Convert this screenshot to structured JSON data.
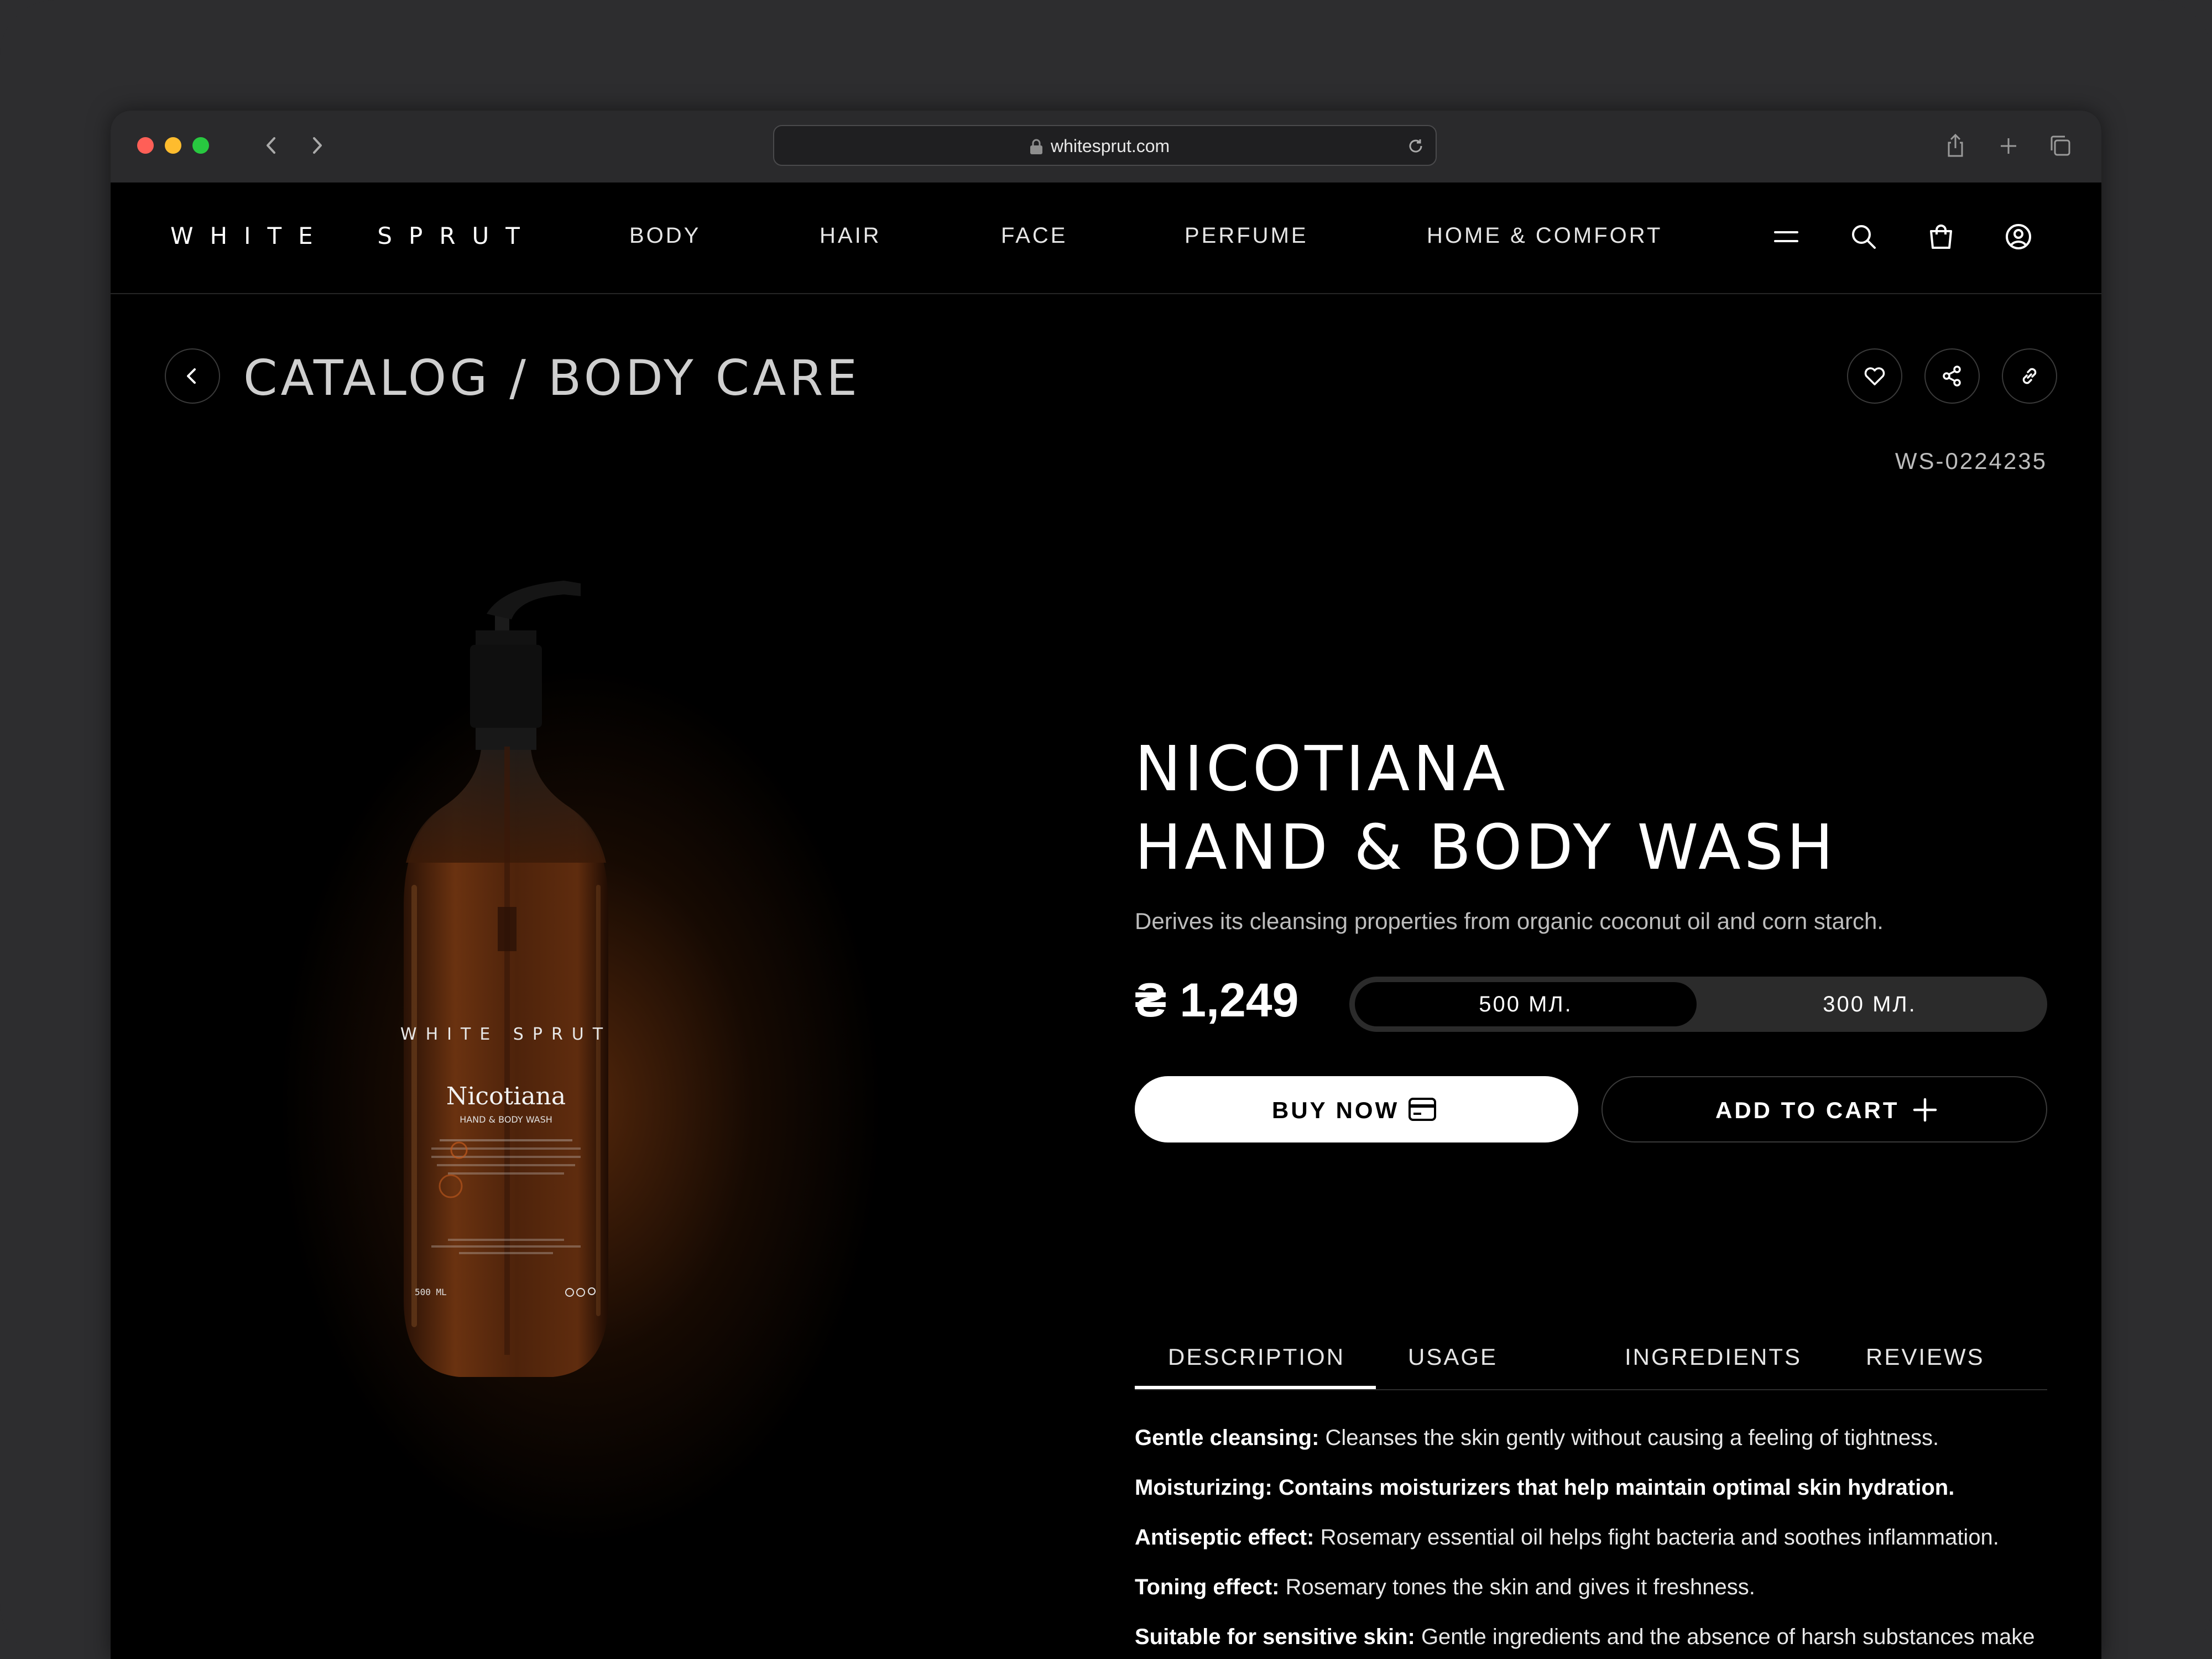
{
  "browser": {
    "url": "whitesprut.com"
  },
  "header": {
    "logo": "WHITE  SPRUT",
    "nav": [
      "BODY",
      "HAIR",
      "FACE",
      "PERFUME",
      "HOME & COMFORT"
    ]
  },
  "breadcrumb": {
    "text": "CATALOG / BODY CARE"
  },
  "product": {
    "sku": "WS-0224235",
    "title_line1": "NICOTIANA",
    "title_line2": "HAND & BODY WASH",
    "description": "Derives its cleansing properties from organic coconut oil and corn starch.",
    "price": "₴ 1,249",
    "sizes": [
      {
        "label": "500 МЛ.",
        "selected": true
      },
      {
        "label": "300 МЛ.",
        "selected": false
      }
    ],
    "buy_label": "BUY NOW",
    "cart_label": "ADD TO CART",
    "label_brand": "WHITE SPRUT",
    "label_name": "Nicotiana",
    "label_sub": "HAND & BODY WASH",
    "label_volume": "500 ML"
  },
  "tabs": [
    "DESCRIPTION",
    "USAGE",
    "INGREDIENTS",
    "REVIEWS"
  ],
  "active_tab": "DESCRIPTION",
  "description_items": [
    {
      "title": "Gentle cleansing:",
      "text": " Cleanses the skin gently without causing a feeling of tightness."
    },
    {
      "title": "Moisturizing: Contains moisturizers that help maintain optimal skin hydration.",
      "text": ""
    },
    {
      "title": "Antiseptic effect:",
      "text": " Rosemary essential oil helps fight bacteria and soothes inflammation."
    },
    {
      "title": "Toning effect:",
      "text": " Rosemary tones the skin and gives it freshness."
    },
    {
      "title": "Suitable for sensitive skin:",
      "text": " Gentle ingredients and the absence of harsh substances make this soap safe for sensitive skin."
    }
  ],
  "colors": {
    "background": "#000000",
    "frame": "#2d2d2f",
    "bottle": "#5a2a10",
    "accent": "#ffffff"
  }
}
